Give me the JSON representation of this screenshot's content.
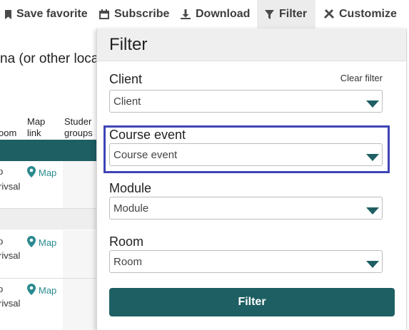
{
  "toolbar": {
    "save_favorite": "Save favorite",
    "subscribe": "Subscribe",
    "download": "Download",
    "filter": "Filter",
    "customize": "Customize"
  },
  "background": {
    "heading": "na (or other loca",
    "columns": {
      "room": "oom",
      "map_link": "Map\nlink",
      "student_groups": "Studer\ngroups"
    },
    "rows": [
      {
        "fragment_top": "p",
        "fragment_bottom": "rivsal",
        "map_label": "Map"
      },
      {
        "fragment_top": "p",
        "fragment_bottom": "rivsal",
        "map_label": "Map"
      },
      {
        "fragment_top": "p",
        "fragment_bottom": "rivsal",
        "map_label": "Map"
      }
    ]
  },
  "filter_panel": {
    "title": "Filter",
    "clear_filter": "Clear filter",
    "fields": [
      {
        "label": "Client",
        "value": "Client"
      },
      {
        "label": "Course event",
        "value": "Course event"
      },
      {
        "label": "Module",
        "value": "Module"
      },
      {
        "label": "Room",
        "value": "Room"
      }
    ],
    "submit_label": "Filter"
  },
  "colors": {
    "accent": "#1e5f63",
    "highlight": "#3f44b6",
    "link": "#2a8a8f"
  }
}
